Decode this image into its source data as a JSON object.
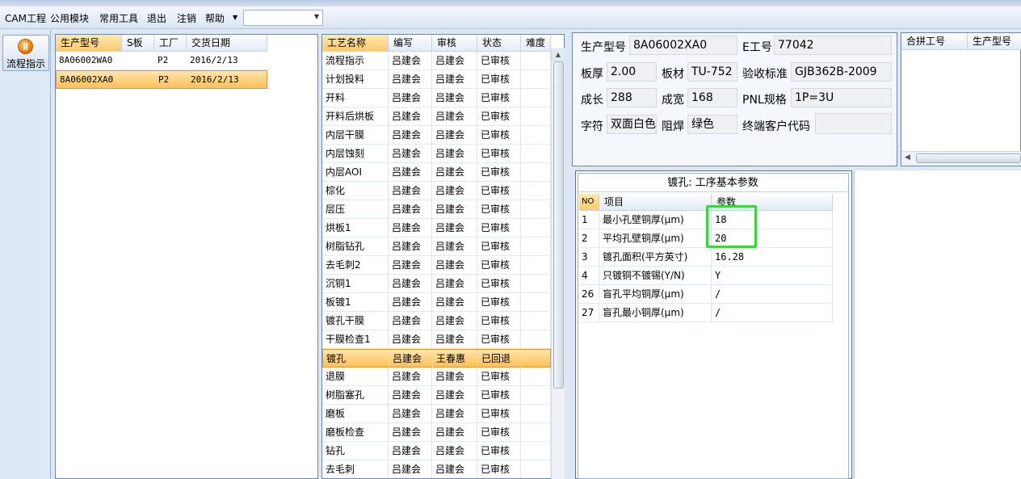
{
  "menu": {
    "items": [
      "CAM工程",
      "公用模块",
      "常用工具",
      "退出",
      "注销",
      "帮助"
    ],
    "combo_value": ""
  },
  "nav": {
    "flow_button": "流程指示"
  },
  "orders": {
    "columns": [
      "生产型号",
      "S板",
      "工厂",
      "交货日期"
    ],
    "rows": [
      [
        "8A06002WA0",
        "",
        "P2",
        "2016/2/13"
      ],
      [
        "8A06002XA0",
        "",
        "P2",
        "2016/2/13"
      ]
    ],
    "selected_index": 1
  },
  "process": {
    "columns": [
      "工艺名称",
      "编写",
      "审核",
      "状态",
      "难度"
    ],
    "rows": [
      [
        "流程指示",
        "吕建会",
        "吕建会",
        "已审核",
        ""
      ],
      [
        "计划投料",
        "吕建会",
        "吕建会",
        "已审核",
        ""
      ],
      [
        "开料",
        "吕建会",
        "吕建会",
        "已审核",
        ""
      ],
      [
        "开料后烘板",
        "吕建会",
        "吕建会",
        "已审核",
        ""
      ],
      [
        "内层干膜",
        "吕建会",
        "吕建会",
        "已审核",
        ""
      ],
      [
        "内层蚀刻",
        "吕建会",
        "吕建会",
        "已审核",
        ""
      ],
      [
        "内层AOI",
        "吕建会",
        "吕建会",
        "已审核",
        ""
      ],
      [
        "棕化",
        "吕建会",
        "吕建会",
        "已审核",
        ""
      ],
      [
        "层压",
        "吕建会",
        "吕建会",
        "已审核",
        ""
      ],
      [
        "烘板1",
        "吕建会",
        "吕建会",
        "已审核",
        ""
      ],
      [
        "树脂钻孔",
        "吕建会",
        "吕建会",
        "已审核",
        ""
      ],
      [
        "去毛刺2",
        "吕建会",
        "吕建会",
        "已审核",
        ""
      ],
      [
        "沉铜1",
        "吕建会",
        "吕建会",
        "已审核",
        ""
      ],
      [
        "板镀1",
        "吕建会",
        "吕建会",
        "已审核",
        ""
      ],
      [
        "镀孔干膜",
        "吕建会",
        "吕建会",
        "已审核",
        ""
      ],
      [
        "干膜检查1",
        "吕建会",
        "吕建会",
        "已审核",
        ""
      ],
      [
        "镀孔",
        "吕建会",
        "王春惠",
        "已回退",
        ""
      ],
      [
        "退膜",
        "吕建会",
        "吕建会",
        "已审核",
        ""
      ],
      [
        "树脂塞孔",
        "吕建会",
        "吕建会",
        "已审核",
        ""
      ],
      [
        "磨板",
        "吕建会",
        "吕建会",
        "已审核",
        ""
      ],
      [
        "磨板检查",
        "吕建会",
        "吕建会",
        "已审核",
        ""
      ],
      [
        "钻孔",
        "吕建会",
        "吕建会",
        "已审核",
        ""
      ],
      [
        "去毛刺",
        "吕建会",
        "吕建会",
        "已审核",
        ""
      ]
    ],
    "selected_index": 16
  },
  "info": {
    "model_label": "生产型号",
    "model_value": "8A06002XA0",
    "e_label": "E工号",
    "e_value": "77042",
    "thickness_label": "板厚",
    "thickness_value": "2.00",
    "material_label": "板材",
    "material_value": "TU-752",
    "standard_label": "验收标准",
    "standard_value": "GJB362B-2009",
    "length_label": "成长",
    "length_value": "288",
    "width_label": "成宽",
    "width_value": "168",
    "pnl_label": "PNL规格",
    "pnl_value": "1P=3U",
    "char_label": "字符",
    "char_value": "双面白色",
    "mask_label": "阻焊",
    "mask_value": "绿色",
    "customer_label": "终端客户代码",
    "customer_value": ""
  },
  "merge": {
    "columns": [
      "合拼工号",
      "生产型号"
    ]
  },
  "params": {
    "title": "镀孔: 工序基本参数",
    "columns": [
      "NO",
      "项目",
      "参数"
    ],
    "rows": [
      [
        "1",
        "最小孔壁铜厚(μm)",
        "18"
      ],
      [
        "2",
        "平均孔壁铜厚(μm)",
        "20"
      ],
      [
        "3",
        "镀孔面积(平方英寸)",
        "16.28"
      ],
      [
        "4",
        "只镀铜不镀锡(Y/N)",
        "Y"
      ],
      [
        "26",
        "盲孔平均铜厚(μm)",
        "/"
      ],
      [
        "27",
        "盲孔最小铜厚(μm)",
        "/"
      ]
    ]
  },
  "colors": {
    "selection": "#ffc96a",
    "highlight_box": "#3ed43e",
    "panel_bg": "#dde7f4"
  }
}
